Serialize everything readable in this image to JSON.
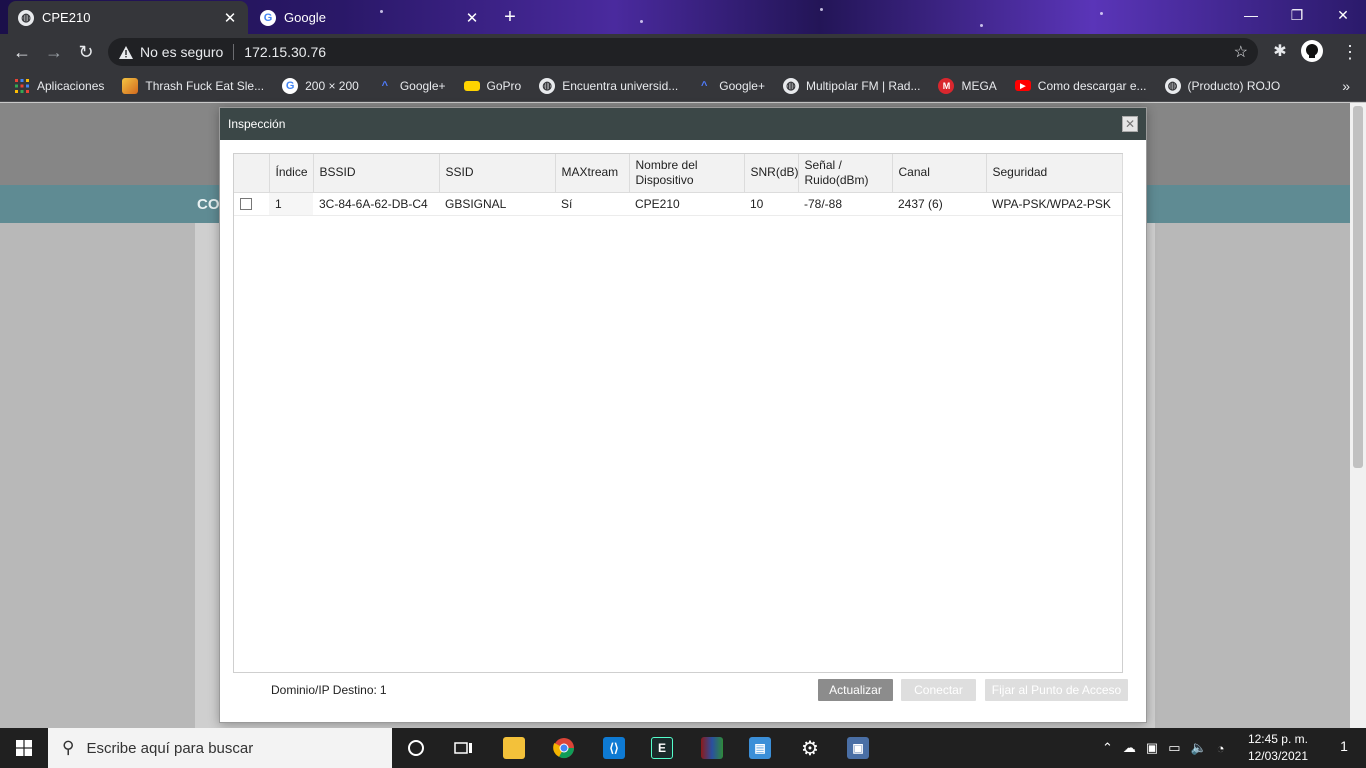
{
  "browser": {
    "tabs": [
      {
        "title": "CPE210",
        "active": true
      },
      {
        "title": "Google",
        "active": false
      }
    ],
    "address": {
      "security": "No es seguro",
      "url": "172.15.30.76"
    },
    "bookmarks": [
      {
        "label": "Aplicaciones",
        "icon": "apps-grid-icon",
        "color": "#4285f4"
      },
      {
        "label": "Thrash Fuck Eat Sle...",
        "icon": "image-icon",
        "color": "#d2691e"
      },
      {
        "label": "200 × 200",
        "icon": "google-icon",
        "color": "#ffffff"
      },
      {
        "label": "Google+",
        "icon": "google-plus-icon",
        "color": "#4f7cff"
      },
      {
        "label": "GoPro",
        "icon": "gopro-icon",
        "color": "#ffd400"
      },
      {
        "label": "Encuentra universid...",
        "icon": "globe-icon",
        "color": "#e8eaed"
      },
      {
        "label": "Google+",
        "icon": "google-plus-icon",
        "color": "#4f7cff"
      },
      {
        "label": "Multipolar FM | Rad...",
        "icon": "globe-icon",
        "color": "#e8eaed"
      },
      {
        "label": "MEGA",
        "icon": "mega-icon",
        "color": "#d9272e"
      },
      {
        "label": "Como descargar e...",
        "icon": "youtube-icon",
        "color": "#ff0000"
      },
      {
        "label": "(Producto) ROJO",
        "icon": "globe-icon",
        "color": "#e8eaed"
      }
    ]
  },
  "page": {
    "nav_text": "CO"
  },
  "modal": {
    "title": "Inspección",
    "table": {
      "headers": [
        "",
        "Índice",
        "BSSID",
        "SSID",
        "MAXtream",
        "Nombre del Dispositivo",
        "SNR(dB)",
        "Señal / Ruido(dBm)",
        "Canal",
        "Seguridad"
      ],
      "rows": [
        {
          "index": "1",
          "bssid": "3C-84-6A-62-DB-C4",
          "ssid": "GBSIGNAL",
          "maxtream": "Sí",
          "device": "CPE210",
          "snr": "10",
          "signal_noise": "-78/-88",
          "channel": "2437 (6)",
          "security": "WPA-PSK/WPA2-PSK"
        }
      ]
    },
    "footer": {
      "domain_label": "Dominio/IP Destino:",
      "domain_value": "1",
      "refresh": "Actualizar",
      "connect": "Conectar",
      "lock_ap": "Fijar al Punto de Acceso"
    }
  },
  "taskbar": {
    "search_placeholder": "Escribe aquí para buscar",
    "time": "12:45 p. m.",
    "date": "12/03/2021",
    "notifications": "1"
  },
  "colors": {
    "modal_header": "#3b4747",
    "page_nav": "#5f8b93",
    "button_primary": "#8c8c8c"
  }
}
